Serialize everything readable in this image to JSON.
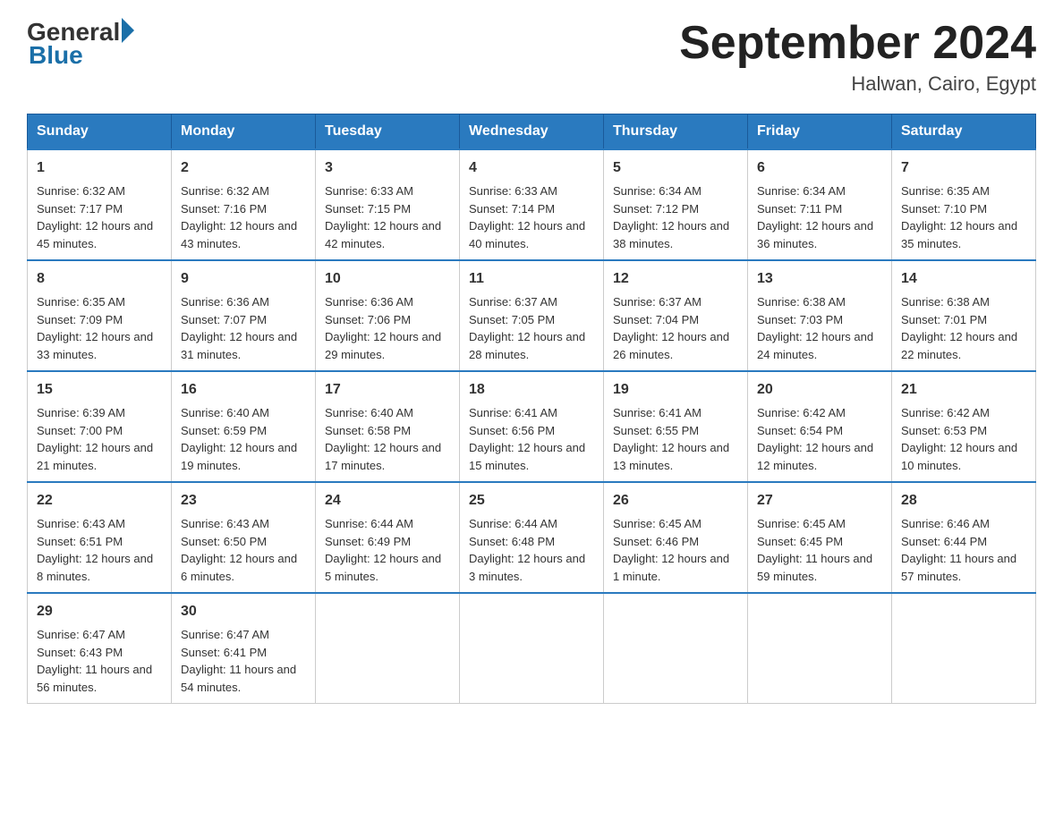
{
  "header": {
    "logo_general": "General",
    "logo_blue": "Blue",
    "title": "September 2024",
    "location": "Halwan, Cairo, Egypt"
  },
  "days_of_week": [
    "Sunday",
    "Monday",
    "Tuesday",
    "Wednesday",
    "Thursday",
    "Friday",
    "Saturday"
  ],
  "weeks": [
    [
      {
        "day": "1",
        "sunrise": "Sunrise: 6:32 AM",
        "sunset": "Sunset: 7:17 PM",
        "daylight": "Daylight: 12 hours and 45 minutes."
      },
      {
        "day": "2",
        "sunrise": "Sunrise: 6:32 AM",
        "sunset": "Sunset: 7:16 PM",
        "daylight": "Daylight: 12 hours and 43 minutes."
      },
      {
        "day": "3",
        "sunrise": "Sunrise: 6:33 AM",
        "sunset": "Sunset: 7:15 PM",
        "daylight": "Daylight: 12 hours and 42 minutes."
      },
      {
        "day": "4",
        "sunrise": "Sunrise: 6:33 AM",
        "sunset": "Sunset: 7:14 PM",
        "daylight": "Daylight: 12 hours and 40 minutes."
      },
      {
        "day": "5",
        "sunrise": "Sunrise: 6:34 AM",
        "sunset": "Sunset: 7:12 PM",
        "daylight": "Daylight: 12 hours and 38 minutes."
      },
      {
        "day": "6",
        "sunrise": "Sunrise: 6:34 AM",
        "sunset": "Sunset: 7:11 PM",
        "daylight": "Daylight: 12 hours and 36 minutes."
      },
      {
        "day": "7",
        "sunrise": "Sunrise: 6:35 AM",
        "sunset": "Sunset: 7:10 PM",
        "daylight": "Daylight: 12 hours and 35 minutes."
      }
    ],
    [
      {
        "day": "8",
        "sunrise": "Sunrise: 6:35 AM",
        "sunset": "Sunset: 7:09 PM",
        "daylight": "Daylight: 12 hours and 33 minutes."
      },
      {
        "day": "9",
        "sunrise": "Sunrise: 6:36 AM",
        "sunset": "Sunset: 7:07 PM",
        "daylight": "Daylight: 12 hours and 31 minutes."
      },
      {
        "day": "10",
        "sunrise": "Sunrise: 6:36 AM",
        "sunset": "Sunset: 7:06 PM",
        "daylight": "Daylight: 12 hours and 29 minutes."
      },
      {
        "day": "11",
        "sunrise": "Sunrise: 6:37 AM",
        "sunset": "Sunset: 7:05 PM",
        "daylight": "Daylight: 12 hours and 28 minutes."
      },
      {
        "day": "12",
        "sunrise": "Sunrise: 6:37 AM",
        "sunset": "Sunset: 7:04 PM",
        "daylight": "Daylight: 12 hours and 26 minutes."
      },
      {
        "day": "13",
        "sunrise": "Sunrise: 6:38 AM",
        "sunset": "Sunset: 7:03 PM",
        "daylight": "Daylight: 12 hours and 24 minutes."
      },
      {
        "day": "14",
        "sunrise": "Sunrise: 6:38 AM",
        "sunset": "Sunset: 7:01 PM",
        "daylight": "Daylight: 12 hours and 22 minutes."
      }
    ],
    [
      {
        "day": "15",
        "sunrise": "Sunrise: 6:39 AM",
        "sunset": "Sunset: 7:00 PM",
        "daylight": "Daylight: 12 hours and 21 minutes."
      },
      {
        "day": "16",
        "sunrise": "Sunrise: 6:40 AM",
        "sunset": "Sunset: 6:59 PM",
        "daylight": "Daylight: 12 hours and 19 minutes."
      },
      {
        "day": "17",
        "sunrise": "Sunrise: 6:40 AM",
        "sunset": "Sunset: 6:58 PM",
        "daylight": "Daylight: 12 hours and 17 minutes."
      },
      {
        "day": "18",
        "sunrise": "Sunrise: 6:41 AM",
        "sunset": "Sunset: 6:56 PM",
        "daylight": "Daylight: 12 hours and 15 minutes."
      },
      {
        "day": "19",
        "sunrise": "Sunrise: 6:41 AM",
        "sunset": "Sunset: 6:55 PM",
        "daylight": "Daylight: 12 hours and 13 minutes."
      },
      {
        "day": "20",
        "sunrise": "Sunrise: 6:42 AM",
        "sunset": "Sunset: 6:54 PM",
        "daylight": "Daylight: 12 hours and 12 minutes."
      },
      {
        "day": "21",
        "sunrise": "Sunrise: 6:42 AM",
        "sunset": "Sunset: 6:53 PM",
        "daylight": "Daylight: 12 hours and 10 minutes."
      }
    ],
    [
      {
        "day": "22",
        "sunrise": "Sunrise: 6:43 AM",
        "sunset": "Sunset: 6:51 PM",
        "daylight": "Daylight: 12 hours and 8 minutes."
      },
      {
        "day": "23",
        "sunrise": "Sunrise: 6:43 AM",
        "sunset": "Sunset: 6:50 PM",
        "daylight": "Daylight: 12 hours and 6 minutes."
      },
      {
        "day": "24",
        "sunrise": "Sunrise: 6:44 AM",
        "sunset": "Sunset: 6:49 PM",
        "daylight": "Daylight: 12 hours and 5 minutes."
      },
      {
        "day": "25",
        "sunrise": "Sunrise: 6:44 AM",
        "sunset": "Sunset: 6:48 PM",
        "daylight": "Daylight: 12 hours and 3 minutes."
      },
      {
        "day": "26",
        "sunrise": "Sunrise: 6:45 AM",
        "sunset": "Sunset: 6:46 PM",
        "daylight": "Daylight: 12 hours and 1 minute."
      },
      {
        "day": "27",
        "sunrise": "Sunrise: 6:45 AM",
        "sunset": "Sunset: 6:45 PM",
        "daylight": "Daylight: 11 hours and 59 minutes."
      },
      {
        "day": "28",
        "sunrise": "Sunrise: 6:46 AM",
        "sunset": "Sunset: 6:44 PM",
        "daylight": "Daylight: 11 hours and 57 minutes."
      }
    ],
    [
      {
        "day": "29",
        "sunrise": "Sunrise: 6:47 AM",
        "sunset": "Sunset: 6:43 PM",
        "daylight": "Daylight: 11 hours and 56 minutes."
      },
      {
        "day": "30",
        "sunrise": "Sunrise: 6:47 AM",
        "sunset": "Sunset: 6:41 PM",
        "daylight": "Daylight: 11 hours and 54 minutes."
      },
      null,
      null,
      null,
      null,
      null
    ]
  ]
}
